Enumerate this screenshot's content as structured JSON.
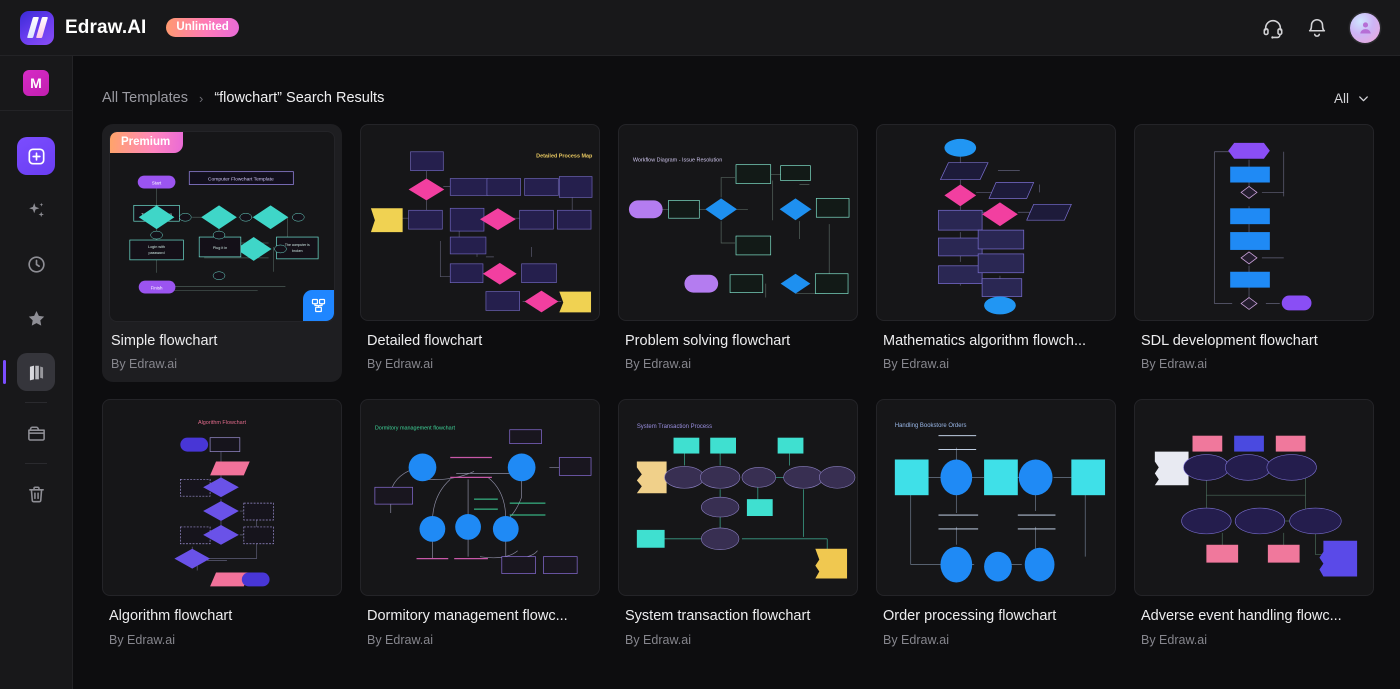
{
  "app": {
    "brand": "Edraw.AI",
    "plan_badge": "Unlimited",
    "logo_icon": "edraw-logo-icon",
    "support_icon": "headset-icon",
    "notification_icon": "bell-icon",
    "avatar_icon": "user-avatar-icon",
    "accent": "#7b4dff",
    "bg": "#0d0d0f",
    "panel": "#18181a"
  },
  "sidebar": {
    "workspace_initial": "M",
    "items": [
      {
        "name": "create-new",
        "icon": "plus-square-icon",
        "active": false,
        "highlight": true
      },
      {
        "name": "ai-tools",
        "icon": "sparkle-icon",
        "active": false,
        "highlight": false
      },
      {
        "name": "recent",
        "icon": "clock-icon",
        "active": false,
        "highlight": false
      },
      {
        "name": "favorites",
        "icon": "star-icon",
        "active": false,
        "highlight": false
      },
      {
        "name": "templates",
        "icon": "templates-icon",
        "active": true,
        "highlight": false
      },
      {
        "name": "files",
        "icon": "folder-icon",
        "active": false,
        "highlight": false
      },
      {
        "name": "trash",
        "icon": "trash-icon",
        "active": false,
        "highlight": false
      }
    ]
  },
  "breadcrumb": {
    "root": "All Templates",
    "separator": "›",
    "current": "“flowchart” Search Results"
  },
  "filter": {
    "label": "All",
    "icon": "chevron-down-icon"
  },
  "templates": [
    {
      "title": "Simple flowchart",
      "author": "By Edraw.ai",
      "premium": "Premium",
      "hovered": true,
      "badge": "flowchart-type-icon",
      "thumb": "t1"
    },
    {
      "title": "Detailed flowchart",
      "author": "By Edraw.ai",
      "premium": null,
      "hovered": false,
      "badge": null,
      "thumb": "t2"
    },
    {
      "title": "Problem solving flowchart",
      "author": "By Edraw.ai",
      "premium": null,
      "hovered": false,
      "badge": null,
      "thumb": "t3"
    },
    {
      "title": "Mathematics algorithm flowch...",
      "author": "By Edraw.ai",
      "premium": null,
      "hovered": false,
      "badge": null,
      "thumb": "t4"
    },
    {
      "title": "SDL development flowchart",
      "author": "By Edraw.ai",
      "premium": null,
      "hovered": false,
      "badge": null,
      "thumb": "t5"
    },
    {
      "title": "Algorithm flowchart",
      "author": "By Edraw.ai",
      "premium": null,
      "hovered": false,
      "badge": null,
      "thumb": "t6"
    },
    {
      "title": "Dormitory management flowc...",
      "author": "By Edraw.ai",
      "premium": null,
      "hovered": false,
      "badge": null,
      "thumb": "t7"
    },
    {
      "title": "System transaction flowchart",
      "author": "By Edraw.ai",
      "premium": null,
      "hovered": false,
      "badge": null,
      "thumb": "t8"
    },
    {
      "title": "Order processing flowchart",
      "author": "By Edraw.ai",
      "premium": null,
      "hovered": false,
      "badge": null,
      "thumb": "t9"
    },
    {
      "title": "Adverse event handling flowc...",
      "author": "By Edraw.ai",
      "premium": null,
      "hovered": false,
      "badge": null,
      "thumb": "t10"
    }
  ],
  "thumbnail_titles": {
    "t1": "Computer Flowchart Template",
    "t2": "Detailed Process Map",
    "t3": "Workflow Diagram - Issue Resolution",
    "t4": "",
    "t5": "",
    "t6": "Algorithm Flowchart",
    "t7": "Dormitory management flowchart",
    "t8": "System Transaction Process",
    "t9": "Handling Bookstore Orders",
    "t10": ""
  }
}
